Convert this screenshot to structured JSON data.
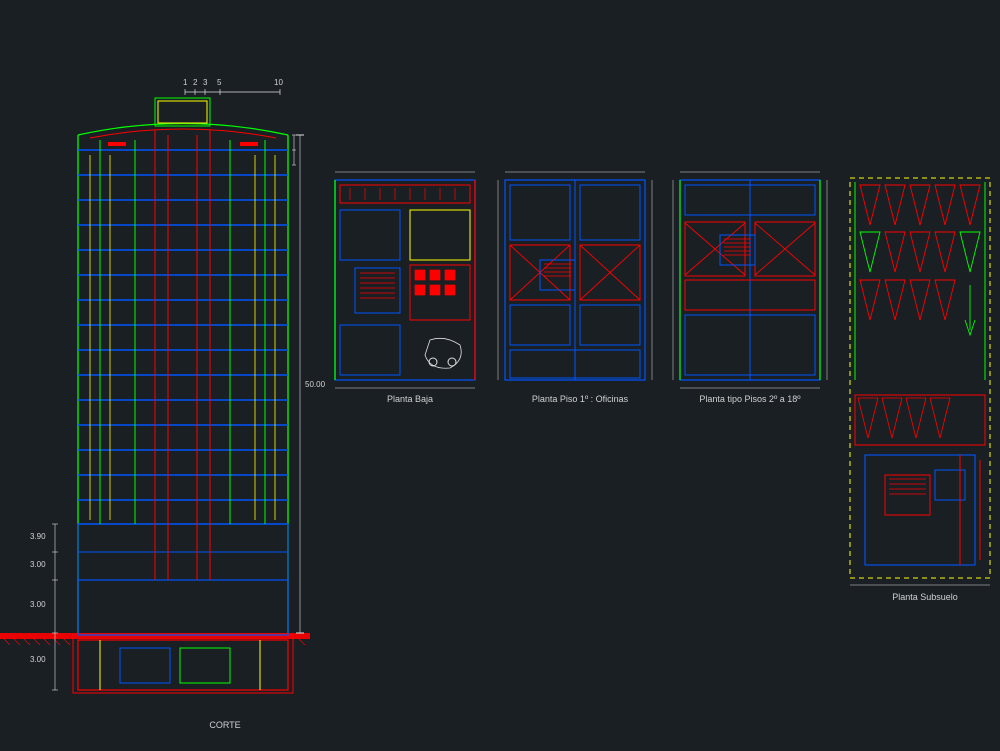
{
  "section": {
    "title": "CORTE",
    "height_label": "50.00",
    "scale_ticks": [
      "1",
      "2",
      "3",
      "5",
      "10"
    ],
    "left_dims": [
      "3.90",
      "3.00",
      "3.00",
      "3.00"
    ]
  },
  "plans": {
    "ground": {
      "title": "Planta Baja"
    },
    "first": {
      "title": "Planta Piso 1º : Oficinas"
    },
    "typical": {
      "title": "Planta tipo Pisos 2º a 18º"
    },
    "basement": {
      "title": "Planta Subsuelo"
    }
  },
  "colors": {
    "red": "#ff0000",
    "blue": "#0055ff",
    "green": "#00ff00",
    "yellow": "#ffff00",
    "white": "#e0e0e0",
    "bg": "#1a1f23"
  }
}
